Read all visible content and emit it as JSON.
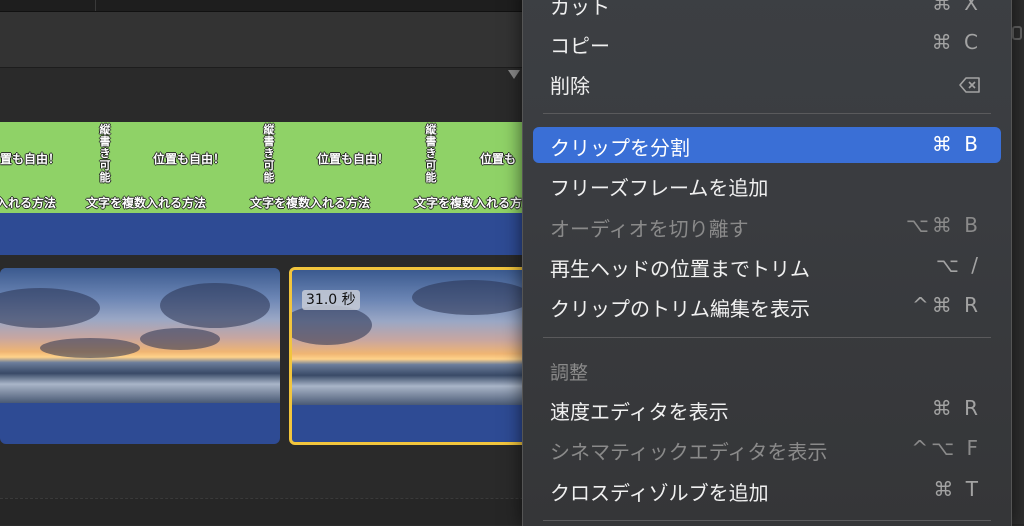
{
  "titles": {
    "horizontal": "位置も自由！",
    "vertical": "縦書き可能",
    "bottom": "文字を複数入れる方法",
    "bottom_left_fragment": "入れる方法",
    "left_fragment": "置も自由！",
    "right_fragment": "位置も"
  },
  "clips": {
    "selected_duration": "31.0 秒"
  },
  "colors": {
    "title_track": "#8fd267",
    "clip_band": "#2e4b94",
    "selection_border": "#f2c53d",
    "menu_highlight": "#3a6fd6"
  },
  "menu": {
    "cut": {
      "label": "カット",
      "shortcut": "⌘ X"
    },
    "copy": {
      "label": "コピー",
      "shortcut": "⌘ C"
    },
    "delete": {
      "label": "削除",
      "shortcut_icon": "delete-key-icon"
    },
    "split_clip": {
      "label": "クリップを分割",
      "shortcut": "⌘ B"
    },
    "freeze_frame": {
      "label": "フリーズフレームを追加",
      "shortcut": ""
    },
    "detach_audio": {
      "label": "オーディオを切り離す",
      "shortcut": "⌥⌘ B"
    },
    "trim_to_playhead": {
      "label": "再生ヘッドの位置までトリム",
      "shortcut": "⌥ /"
    },
    "show_trim_editor": {
      "label": "クリップのトリム編集を表示",
      "shortcut": "^⌘ R"
    },
    "adjust_header": "調整",
    "speed_editor": {
      "label": "速度エディタを表示",
      "shortcut": "⌘ R"
    },
    "cinematic_editor": {
      "label": "シネマティックエディタを表示",
      "shortcut": "^⌥ F"
    },
    "cross_dissolve": {
      "label": "クロスディゾルブを追加",
      "shortcut": "⌘ T"
    }
  }
}
